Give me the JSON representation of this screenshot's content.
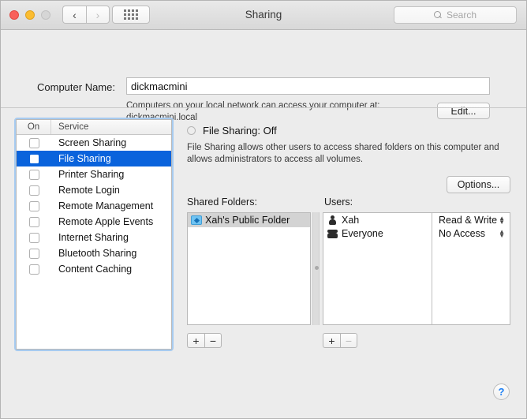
{
  "window": {
    "title": "Sharing",
    "traffic_lights": [
      "close",
      "minimize",
      "zoom"
    ],
    "back_icon": "chevron-left-icon",
    "forward_icon": "chevron-right-icon",
    "grid_icon": "show-all-grid-icon",
    "search": {
      "placeholder": "Search",
      "value": "",
      "icon": "search-icon"
    }
  },
  "computer_name": {
    "label": "Computer Name:",
    "value": "dickmacmini",
    "help_line1": "Computers on your local network can access your computer at:",
    "help_line2": "dickmacmini.local",
    "edit_label": "Edit..."
  },
  "services": {
    "header_on": "On",
    "header_service": "Service",
    "items": [
      {
        "name": "Screen Sharing",
        "on": false,
        "selected": false
      },
      {
        "name": "File Sharing",
        "on": false,
        "selected": true
      },
      {
        "name": "Printer Sharing",
        "on": false,
        "selected": false
      },
      {
        "name": "Remote Login",
        "on": false,
        "selected": false
      },
      {
        "name": "Remote Management",
        "on": false,
        "selected": false
      },
      {
        "name": "Remote Apple Events",
        "on": false,
        "selected": false
      },
      {
        "name": "Internet Sharing",
        "on": false,
        "selected": false
      },
      {
        "name": "Bluetooth Sharing",
        "on": false,
        "selected": false
      },
      {
        "name": "Content Caching",
        "on": false,
        "selected": false
      }
    ]
  },
  "detail": {
    "status_label": "File Sharing: Off",
    "status_state": "off",
    "description": "File Sharing allows other users to access shared folders on this computer and allows administrators to access all volumes.",
    "options_label": "Options...",
    "shared_folders_label": "Shared Folders:",
    "users_label": "Users:",
    "shared_folders": [
      {
        "name": "Xah's Public Folder",
        "icon": "public-folder-icon",
        "selected": true
      }
    ],
    "users": [
      {
        "name": "Xah",
        "icon": "user-icon",
        "permission": "Read & Write"
      },
      {
        "name": "Everyone",
        "icon": "group-icon",
        "permission": "No Access"
      }
    ],
    "folder_add_label": "+",
    "folder_remove_label": "−",
    "user_add_label": "+",
    "user_remove_label": "−",
    "user_remove_disabled": true
  },
  "help": {
    "label": "?"
  },
  "colors": {
    "selection_blue": "#0a63dc",
    "focus_ring": "#a7cbf0",
    "window_bg": "#ececec",
    "help_blue": "#1b7ef5"
  }
}
